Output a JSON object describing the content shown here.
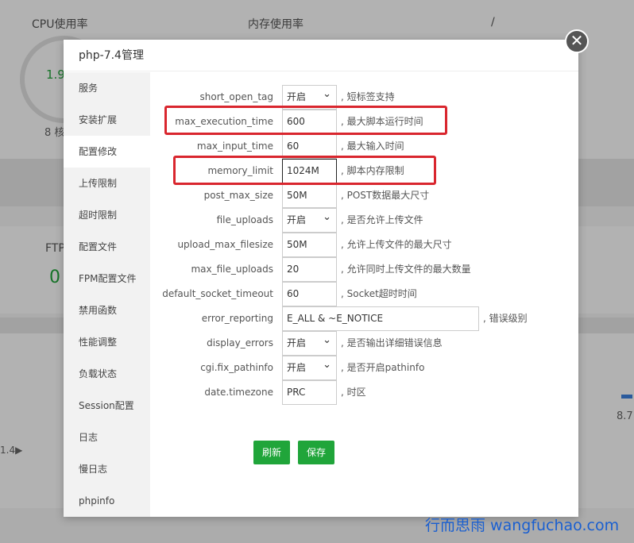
{
  "background": {
    "cpu_label": "CPU使用率",
    "mem_label": "内存使用率",
    "disk_label": "/",
    "cpu_value": "1.9",
    "cores_text": "8 核",
    "ftp_label": "FTP",
    "ftp_value": "0",
    "small_left": "1.4▶",
    "right_value": "8.7"
  },
  "dialog": {
    "title": "php-7.4管理",
    "close_glyph": "✕"
  },
  "sidebar": {
    "items": [
      {
        "label": "服务"
      },
      {
        "label": "安装扩展"
      },
      {
        "label": "配置修改"
      },
      {
        "label": "上传限制"
      },
      {
        "label": "超时限制"
      },
      {
        "label": "配置文件"
      },
      {
        "label": "FPM配置文件"
      },
      {
        "label": "禁用函数"
      },
      {
        "label": "性能调整"
      },
      {
        "label": "负载状态"
      },
      {
        "label": "Session配置"
      },
      {
        "label": "日志"
      },
      {
        "label": "慢日志"
      },
      {
        "label": "phpinfo"
      }
    ],
    "active_index": 2
  },
  "form": {
    "rows": [
      {
        "label": "short_open_tag",
        "value": "开启",
        "desc": ", 短标签支持"
      },
      {
        "label": "max_execution_time",
        "value": "600",
        "desc": ", 最大脚本运行时间"
      },
      {
        "label": "max_input_time",
        "value": "60",
        "desc": ", 最大输入时间"
      },
      {
        "label": "memory_limit",
        "value": "1024M",
        "desc": ", 脚本内存限制"
      },
      {
        "label": "post_max_size",
        "value": "50M",
        "desc": ", POST数据最大尺寸"
      },
      {
        "label": "file_uploads",
        "value": "开启",
        "desc": ", 是否允许上传文件"
      },
      {
        "label": "upload_max_filesize",
        "value": "50M",
        "desc": ", 允许上传文件的最大尺寸"
      },
      {
        "label": "max_file_uploads",
        "value": "20",
        "desc": ", 允许同时上传文件的最大数量"
      },
      {
        "label": "default_socket_timeout",
        "value": "60",
        "desc": ", Socket超时时间"
      },
      {
        "label": "error_reporting",
        "value": "E_ALL & ~E_NOTICE",
        "desc": ", 错误级别"
      },
      {
        "label": "display_errors",
        "value": "开启",
        "desc": ", 是否输出详细错误信息"
      },
      {
        "label": "cgi.fix_pathinfo",
        "value": "开启",
        "desc": ", 是否开启pathinfo"
      },
      {
        "label": "date.timezone",
        "value": "PRC",
        "desc": ", 时区"
      }
    ],
    "refresh_label": "刷新",
    "save_label": "保存"
  },
  "watermark": "行而思雨 wangfuchao.com",
  "colors": {
    "accent_green": "#20a53a",
    "highlight_red": "#d9262e",
    "watermark_blue": "#1a5fd0"
  }
}
